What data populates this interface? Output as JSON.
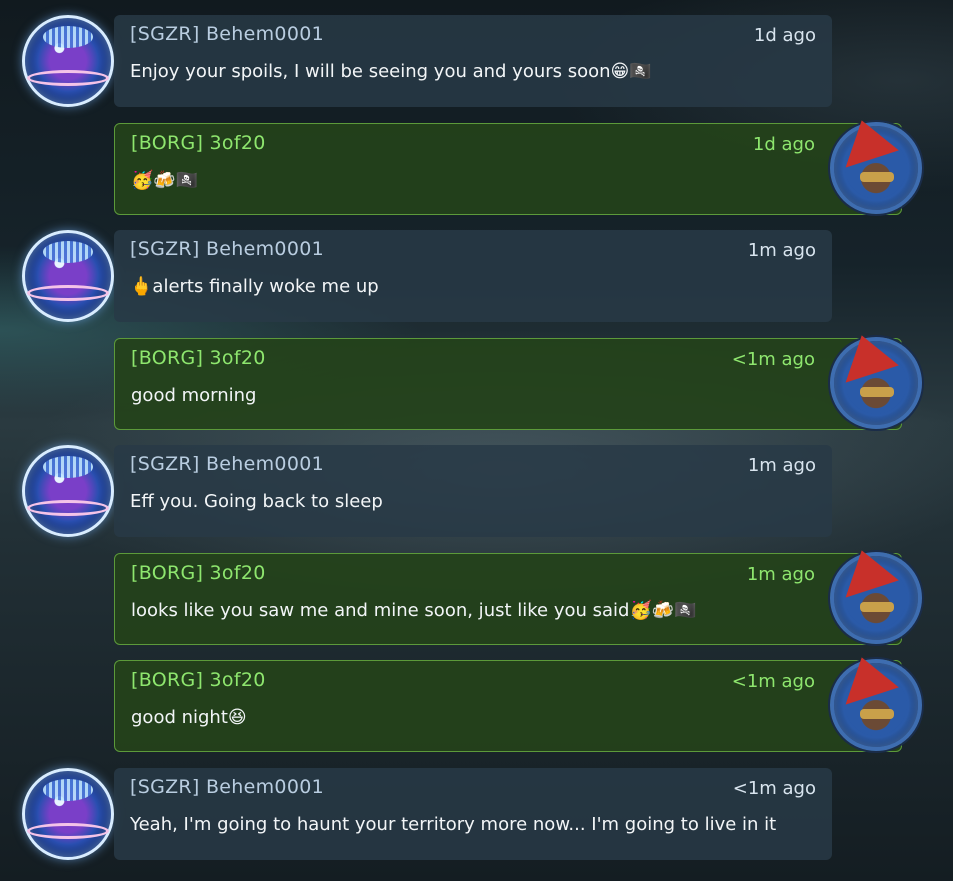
{
  "messages": [
    {
      "side": "them",
      "name": "[SGZR] Behem0001",
      "time": "1d ago",
      "text": "Enjoy your spoils, I will be seeing you and yours soon😁🏴‍☠️"
    },
    {
      "side": "me",
      "name": "[BORG] 3of20",
      "time": "1d ago",
      "text": "🥳🍻🏴‍☠️"
    },
    {
      "side": "them",
      "name": "[SGZR] Behem0001",
      "time": "1m ago",
      "text": "🖕alerts finally woke me up"
    },
    {
      "side": "me",
      "name": "[BORG] 3of20",
      "time": "<1m ago",
      "text": "good morning"
    },
    {
      "side": "them",
      "name": "[SGZR] Behem0001",
      "time": "1m ago",
      "text": "Eff you. Going back to sleep"
    },
    {
      "side": "me",
      "name": "[BORG] 3of20",
      "time": "1m ago",
      "text": "looks like you saw me and mine soon, just like you said🥳🍻🏴‍☠️"
    },
    {
      "side": "me",
      "name": "[BORG] 3of20",
      "time": "<1m ago",
      "text": "good night😆"
    },
    {
      "side": "them",
      "name": "[SGZR] Behem0001",
      "time": "<1m ago",
      "text": "Yeah, I'm going to haunt your territory more now... I'm going to live in it"
    }
  ],
  "avatars": {
    "them": "planet-avatar-icon",
    "me": "jester-avatar-icon"
  },
  "colors": {
    "them_bubble": "#283a46",
    "me_bubble": "#24421a",
    "me_accent": "#8ee66e",
    "them_name": "#b9cde0"
  }
}
